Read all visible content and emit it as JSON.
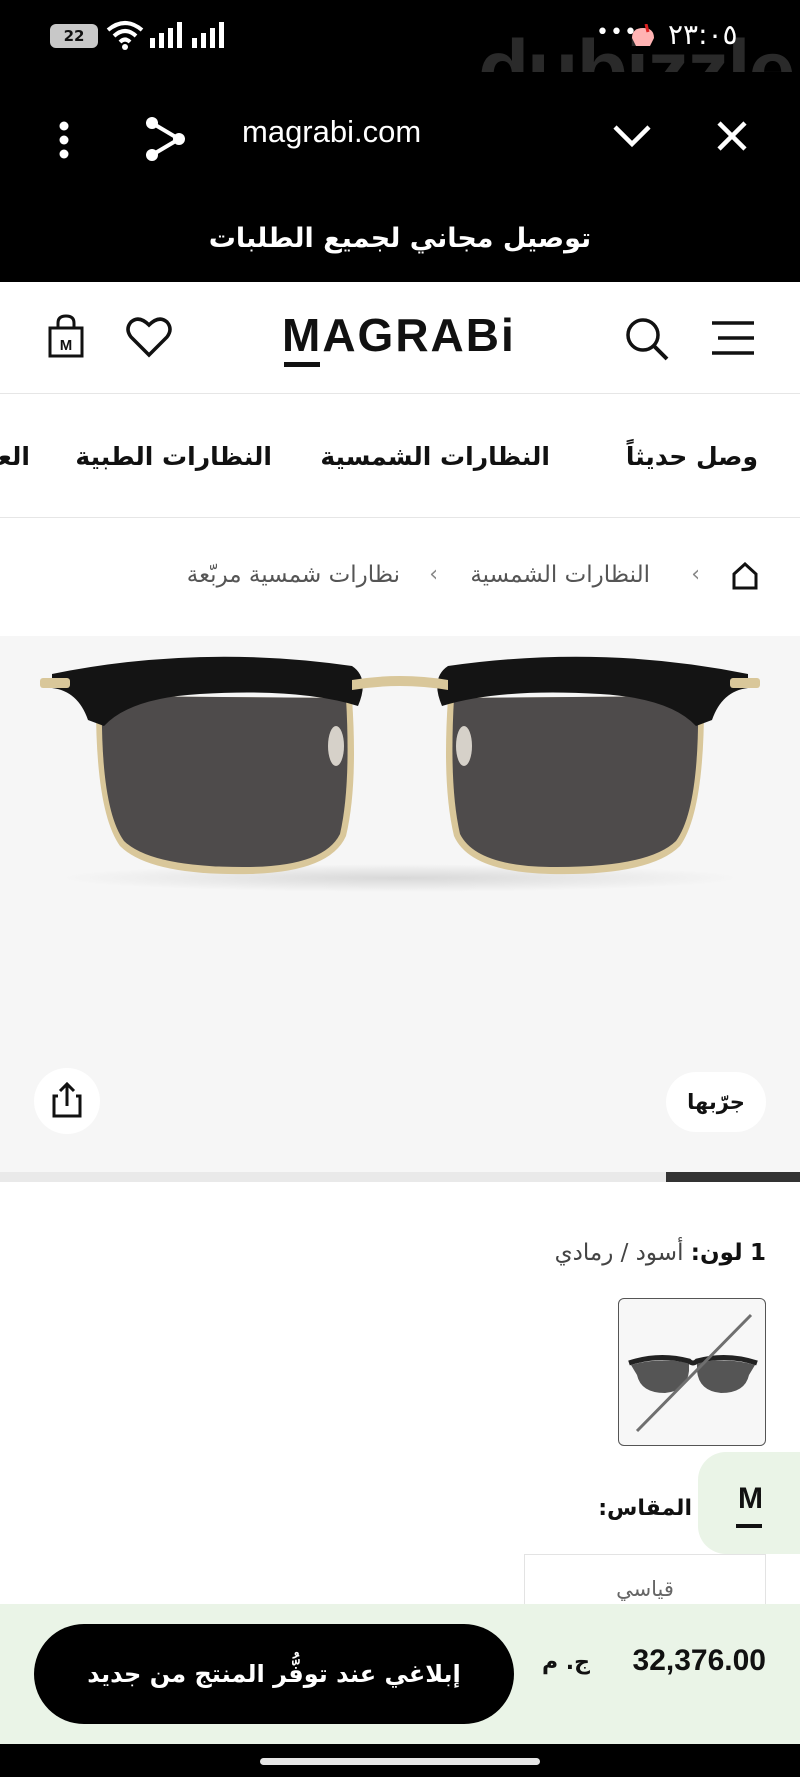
{
  "status_bar": {
    "battery": "22",
    "time": "٢٣:٠٥",
    "more": "•••",
    "watermark": "dubizzle"
  },
  "browser": {
    "url": "magrabi.com"
  },
  "promo": {
    "text": "توصيل مجاني لجميع الطلبات"
  },
  "header": {
    "logo": "MAGRABi",
    "icons": [
      "bag-icon",
      "heart-icon",
      "search-icon",
      "hamburger-icon"
    ]
  },
  "nav": {
    "categories": [
      "وصل حديثاً",
      "النظارات الشمسية",
      "النظارات الطبية",
      "العدسات"
    ]
  },
  "breadcrumb": {
    "items": [
      "النظارات الشمسية",
      "نظارات شمسية مربّعة"
    ]
  },
  "product": {
    "try_label": "جرّبها",
    "color_count": "1",
    "color_label": "لون:",
    "color_value": "أسود / رمادي",
    "size_label": "المقاس:",
    "size_option": "قياسي",
    "price": "32,376.00",
    "currency": "ج. م",
    "notify_label": "إبلاغي عند توفُّر المنتج من جديد"
  },
  "chat_widget": {
    "letter": "M"
  },
  "colors": {
    "black": "#000000",
    "promo_bg": "#000000",
    "bottom_bar_bg": "#eaf4e7",
    "image_bg": "#f6f6f6"
  }
}
